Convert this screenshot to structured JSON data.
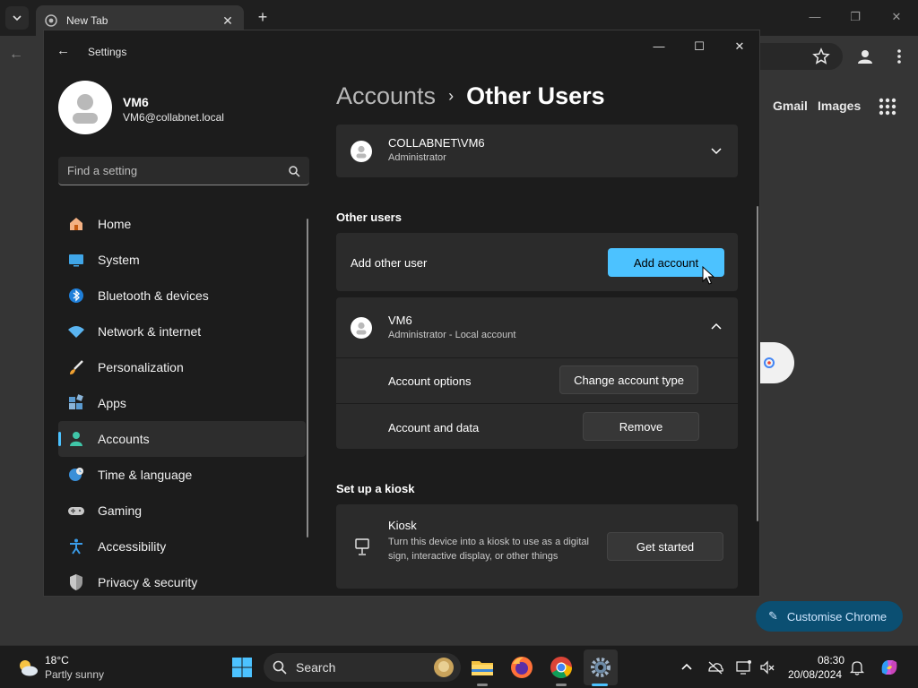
{
  "chrome": {
    "tab_title": "New Tab",
    "gmail": "Gmail",
    "images": "Images",
    "customise": "Customise Chrome"
  },
  "settings": {
    "window_title": "Settings",
    "profile": {
      "name": "VM6",
      "email": "VM6@collabnet.local"
    },
    "search_placeholder": "Find a setting",
    "nav": [
      {
        "label": "Home",
        "icon": "home-icon"
      },
      {
        "label": "System",
        "icon": "system-icon"
      },
      {
        "label": "Bluetooth & devices",
        "icon": "bluetooth-icon"
      },
      {
        "label": "Network & internet",
        "icon": "network-icon"
      },
      {
        "label": "Personalization",
        "icon": "brush-icon"
      },
      {
        "label": "Apps",
        "icon": "apps-icon"
      },
      {
        "label": "Accounts",
        "icon": "accounts-icon",
        "active": true
      },
      {
        "label": "Time & language",
        "icon": "globe-clock-icon"
      },
      {
        "label": "Gaming",
        "icon": "gamepad-icon"
      },
      {
        "label": "Accessibility",
        "icon": "accessibility-icon"
      },
      {
        "label": "Privacy & security",
        "icon": "shield-icon"
      }
    ],
    "breadcrumb": {
      "parent": "Accounts",
      "separator": "›",
      "current": "Other Users"
    },
    "current_user": {
      "name": "COLLABNET\\VM6",
      "role": "Administrator"
    },
    "other_users": {
      "section_title": "Other users",
      "add_label": "Add other user",
      "add_button": "Add account",
      "user": {
        "name": "VM6",
        "role": "Administrator - Local account",
        "options_label": "Account options",
        "options_button": "Change account type",
        "data_label": "Account and data",
        "data_button": "Remove"
      }
    },
    "kiosk": {
      "section_title": "Set up a kiosk",
      "title": "Kiosk",
      "description": "Turn this device into a kiosk to use as a digital sign, interactive display, or other things",
      "button": "Get started"
    }
  },
  "taskbar": {
    "weather_temp": "18°C",
    "weather_desc": "Partly sunny",
    "search_label": "Search",
    "time": "08:30",
    "date": "20/08/2024"
  },
  "colors": {
    "accent": "#4cc2ff",
    "window_bg": "#1c1c1c",
    "card_bg": "#2b2b2b"
  }
}
